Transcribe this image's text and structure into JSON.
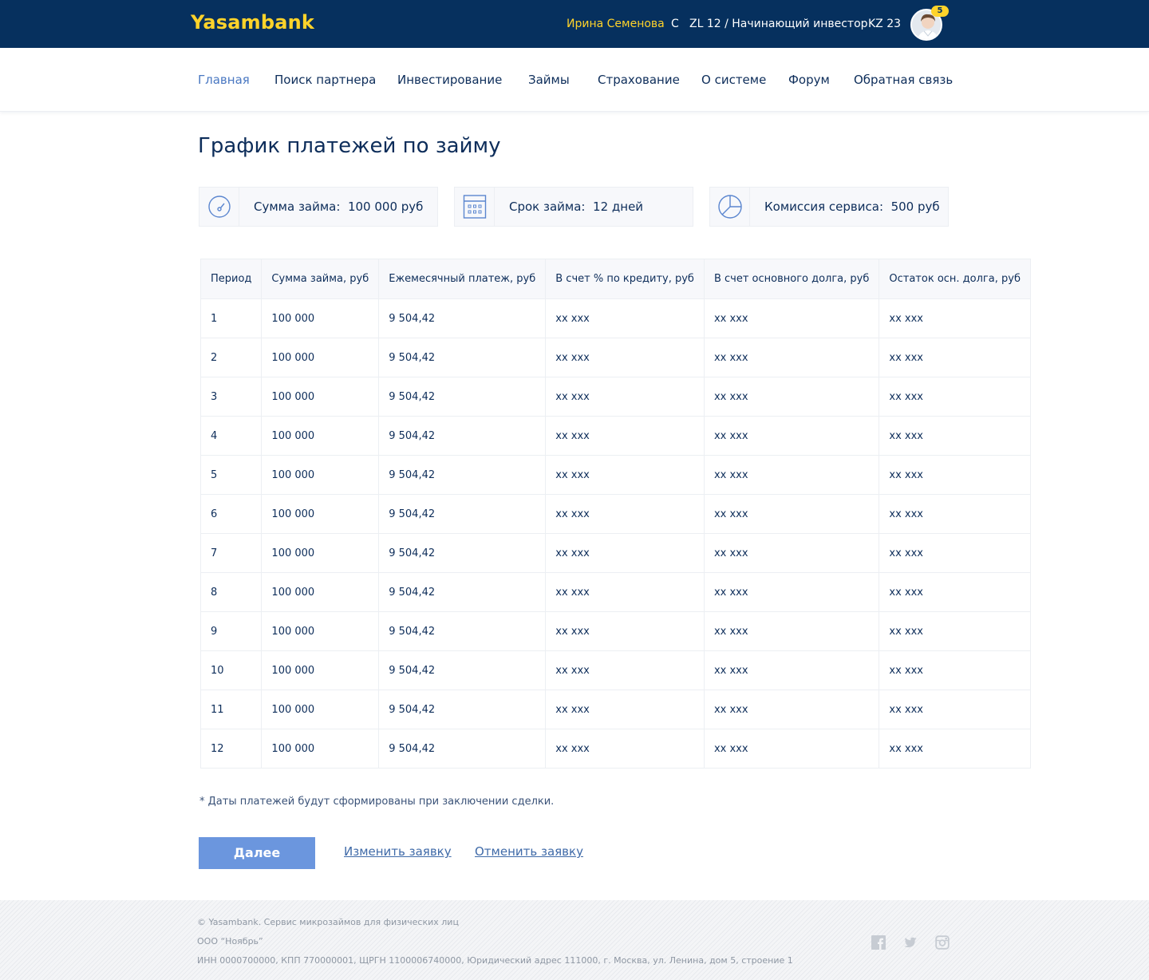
{
  "header": {
    "logo": "Yasambank",
    "user_name": "Ирина Семенова",
    "c_label": "C",
    "level": "ZL 12 / Начинающий инвестор",
    "kz": "KZ 23",
    "notification_count": "5"
  },
  "nav": {
    "items": [
      {
        "label": "Главная",
        "active": true
      },
      {
        "label": "Поиск партнера"
      },
      {
        "label": "Инвестирование"
      },
      {
        "label": "Займы"
      },
      {
        "label": "Страхование"
      },
      {
        "label": "О системе"
      },
      {
        "label": "Форум"
      },
      {
        "label": "Обратная связь"
      }
    ]
  },
  "page": {
    "title": "График платежей по займу"
  },
  "info": {
    "amount": {
      "label": "Сумма займа:",
      "value": "100 000 руб",
      "icon": "speedometer-icon"
    },
    "term": {
      "label": "Срок займа:",
      "value": "12 дней",
      "icon": "calendar-icon"
    },
    "fee": {
      "label": "Комиссия сервиса:",
      "value": "500 руб",
      "icon": "pie-chart-icon"
    }
  },
  "table": {
    "headers": [
      "Период",
      "Сумма займа, руб",
      "Ежемесячный платеж, руб",
      "В счет % по кредиту, руб",
      "В счет основного долга, руб",
      "Остаток осн. долга, руб"
    ],
    "rows": [
      [
        "1",
        "100 000",
        "9 504,42",
        "xx xxx",
        "xx xxx",
        "xx xxx"
      ],
      [
        "2",
        "100 000",
        "9 504,42",
        "xx xxx",
        "xx xxx",
        "xx xxx"
      ],
      [
        "3",
        "100 000",
        "9 504,42",
        "xx xxx",
        "xx xxx",
        "xx xxx"
      ],
      [
        "4",
        "100 000",
        "9 504,42",
        "xx xxx",
        "xx xxx",
        "xx xxx"
      ],
      [
        "5",
        "100 000",
        "9 504,42",
        "xx xxx",
        "xx xxx",
        "xx xxx"
      ],
      [
        "6",
        "100 000",
        "9 504,42",
        "xx xxx",
        "xx xxx",
        "xx xxx"
      ],
      [
        "7",
        "100 000",
        "9 504,42",
        "xx xxx",
        "xx xxx",
        "xx xxx"
      ],
      [
        "8",
        "100 000",
        "9 504,42",
        "xx xxx",
        "xx xxx",
        "xx xxx"
      ],
      [
        "9",
        "100 000",
        "9 504,42",
        "xx xxx",
        "xx xxx",
        "xx xxx"
      ],
      [
        "10",
        "100 000",
        "9 504,42",
        "xx xxx",
        "xx xxx",
        "xx xxx"
      ],
      [
        "11",
        "100 000",
        "9 504,42",
        "xx xxx",
        "xx xxx",
        "xx xxx"
      ],
      [
        "12",
        "100 000",
        "9 504,42",
        "xx xxx",
        "xx xxx",
        "xx xxx"
      ]
    ]
  },
  "note": "* Даты платежей будут сформированы при заключении сделки.",
  "actions": {
    "next": "Далее",
    "edit": "Изменить заявку",
    "cancel": "Отменить заявку"
  },
  "footer": {
    "line1": "© Yasambank. Сервис микрозаймов для физических лиц",
    "line2": "ООО “Ноябрь”",
    "line3": "ИНН 0000700000, КПП 770000001, ЩРГН 1100006740000, Юридический адрес 111000, г. Москва, ул. Ленина, дом 5, строение 1",
    "social": [
      "facebook-icon",
      "twitter-icon",
      "instagram-icon"
    ]
  },
  "colors": {
    "header_bg": "#06305e",
    "accent_yellow": "#ffd32a",
    "nav_active": "#4a78c2",
    "button": "#6b96de",
    "text_dark": "#0d2d5a"
  }
}
